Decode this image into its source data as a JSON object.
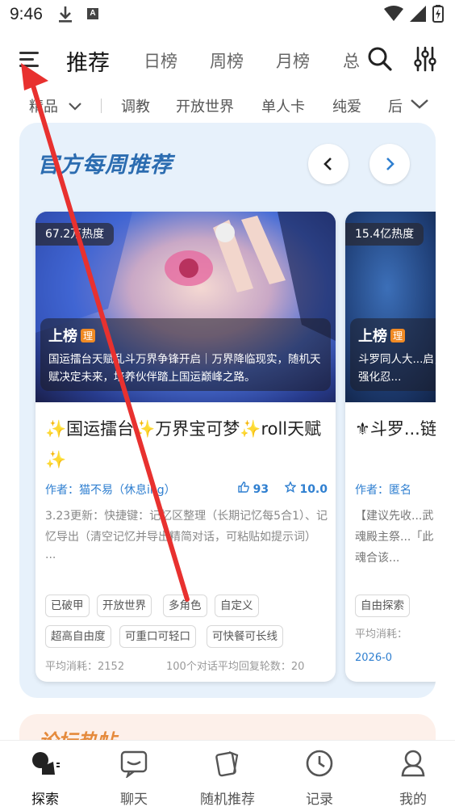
{
  "status": {
    "time": "9:46",
    "a_badge": "A"
  },
  "nav": {
    "tabs": [
      "推荐",
      "日榜",
      "周榜",
      "月榜",
      "总"
    ]
  },
  "categories": {
    "first": "精品",
    "items": [
      "调教",
      "开放世界",
      "单人卡",
      "纯爱",
      "后"
    ]
  },
  "weekly": {
    "title": "官方每周推荐",
    "cards": [
      {
        "heat": "67.2万热度",
        "rank": "上榜",
        "rank_tag": "理",
        "cover_desc": "国运擂台天赋乱斗万界争锋开启｜万界降临现实，随机天赋决定未来，培养伙伴踏上国运巅峰之路。",
        "title": "✨国运擂台✨万界宝可梦✨roll天赋✨",
        "author": "作者：猫不易（休息ing）",
        "likes": "93",
        "score": "10.0",
        "body": "3.23更新：快捷键：记忆区整理（长期记忆每5合1）、记忆导出（清空记忆并导出精简对话，可粘贴如提示词）",
        "ellipsis": "...",
        "tags": [
          "已破甲",
          "开放世界",
          "多角色",
          "自定义",
          "超高自由度",
          "可重口可轻口",
          "可快餐可长线"
        ],
        "foot_left": "平均消耗：2152",
        "foot_right": "100个对话平均回复轮数：20"
      },
      {
        "heat": "15.4亿热度",
        "rank": "上榜",
        "rank_tag": "理",
        "cover_desc": "斗罗同人大...启，强化忍...",
        "title": "⚜斗罗...链】",
        "author": "作者：匿名",
        "body": "【建议先收...武魂殿主祭...「此魂合该...",
        "tags": [
          "自由探索"
        ],
        "foot_left": "平均消耗：",
        "date": "2026-0"
      }
    ]
  },
  "next_section": {
    "title": "论坛热帖"
  },
  "bottom_nav": [
    {
      "label": "探索",
      "icon": "explore-icon",
      "active": true
    },
    {
      "label": "聊天",
      "icon": "chat-icon",
      "active": false
    },
    {
      "label": "随机推荐",
      "icon": "random-card-icon",
      "active": false
    },
    {
      "label": "记录",
      "icon": "clock-icon",
      "active": false
    },
    {
      "label": "我的",
      "icon": "profile-icon",
      "active": false
    }
  ],
  "colors": {
    "accent_blue": "#2b6cb0",
    "annotation_red": "#e8312f",
    "rank_orange": "#f08a24"
  }
}
